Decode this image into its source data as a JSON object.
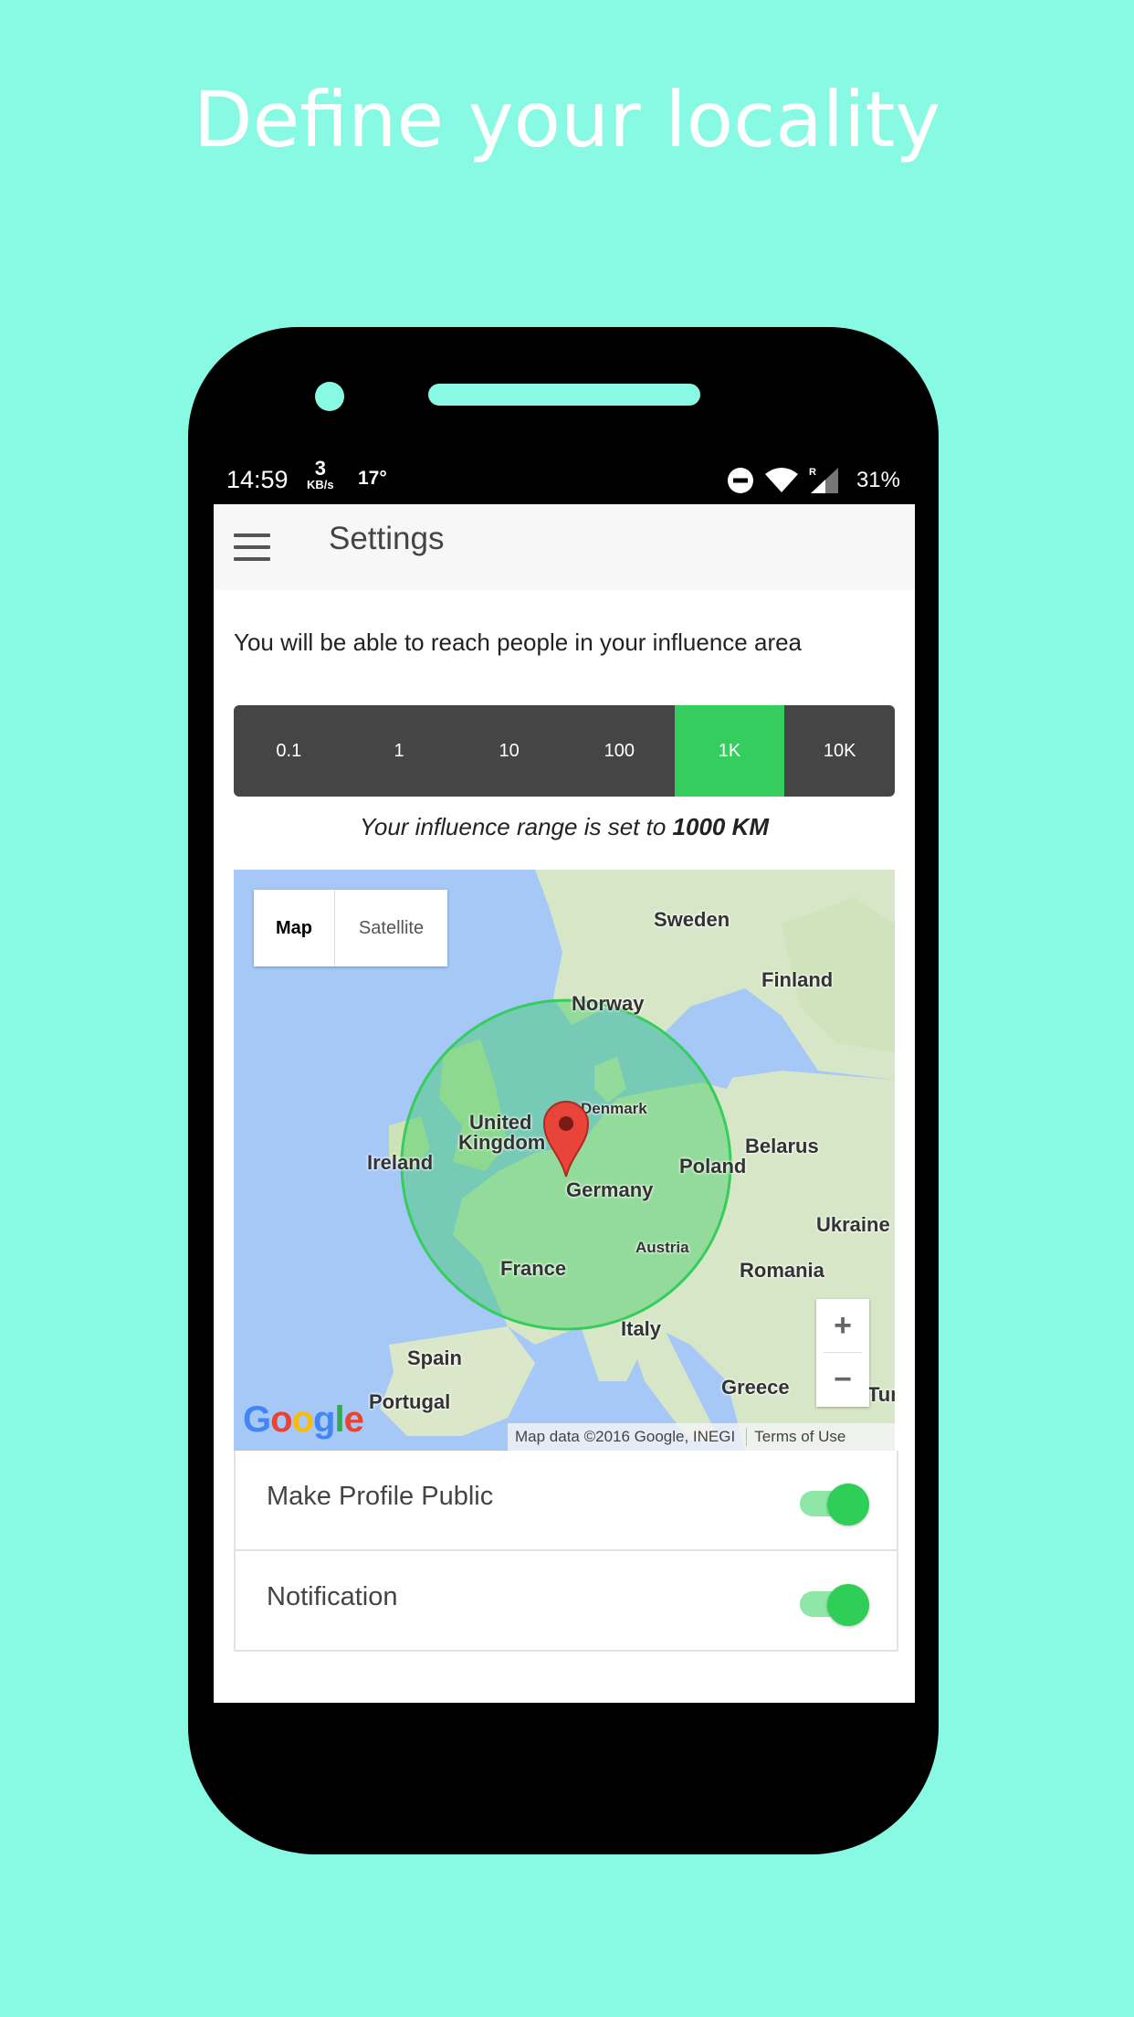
{
  "headline": "Define your locality",
  "status_bar": {
    "time": "14:59",
    "speed_value": "3",
    "speed_unit": "KB/s",
    "temperature": "17°",
    "battery": "31%"
  },
  "app_bar": {
    "title": "Settings"
  },
  "intro_text": "You will be able to reach people in your influence area",
  "range_options": [
    "0.1",
    "1",
    "10",
    "100",
    "1K",
    "10K"
  ],
  "range_selected": "1K",
  "range_text": {
    "prefix": "Your influence range is set to",
    "value": "1000 KM"
  },
  "map": {
    "type_buttons": {
      "map": "Map",
      "satellite": "Satellite"
    },
    "labels": {
      "sweden": "Sweden",
      "finland": "Finland",
      "norway": "Norway",
      "denmark": "Denmark",
      "united": "United",
      "kingdom": "Kingdom",
      "ireland": "Ireland",
      "belarus": "Belarus",
      "poland": "Poland",
      "germany": "Germany",
      "ukraine": "Ukraine",
      "austria": "Austria",
      "france": "France",
      "romania": "Romania",
      "italy": "Italy",
      "spain": "Spain",
      "greece": "Greece",
      "portugal": "Portugal",
      "tur": "Tur"
    },
    "zoom_in": "+",
    "zoom_out": "−",
    "attribution": "Map data ©2016 Google, INEGI",
    "terms": "Terms of Use",
    "google_letters": [
      "G",
      "o",
      "o",
      "g",
      "l",
      "e"
    ],
    "google_colors": [
      "#4285f4",
      "#ea4335",
      "#fbbc05",
      "#4285f4",
      "#34a853",
      "#ea4335"
    ],
    "circle_color": "#34cd5e",
    "pin_color": "#e8443a"
  },
  "settings": [
    {
      "label": "Make Profile Public",
      "enabled": true
    },
    {
      "label": "Notification",
      "enabled": true
    }
  ],
  "colors": {
    "background": "#88f9e2",
    "accent": "#34cd5e",
    "range_bar": "#454545"
  }
}
